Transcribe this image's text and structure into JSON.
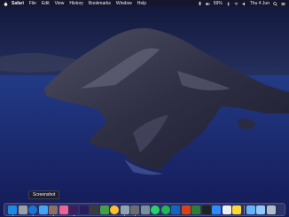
{
  "menubar": {
    "app_name": "Safari",
    "items": [
      "File",
      "Edit",
      "View",
      "History",
      "Bookmarks",
      "Window",
      "Help"
    ],
    "battery_percent": "59%",
    "clock": "Thu 4 Jun",
    "status_icons": [
      "dropbox-icon",
      "wifi-icon",
      "bluetooth-icon",
      "volume-icon",
      "spotlight-icon",
      "siri-icon",
      "menu-extra-icon"
    ]
  },
  "tooltip": {
    "label": "Screenshot"
  },
  "dock": {
    "apps": [
      {
        "name": "finder-icon",
        "color": "#1e88e5"
      },
      {
        "name": "launchpad-icon",
        "color": "#9aa0a6"
      },
      {
        "name": "safari-icon",
        "color": "#1976d2"
      },
      {
        "name": "mail-icon",
        "color": "#42a5f5"
      },
      {
        "name": "contacts-icon",
        "color": "#8d6e63"
      },
      {
        "name": "photos-icon",
        "color": "#f06292"
      },
      {
        "name": "premiere-icon",
        "color": "#3f1d5c"
      },
      {
        "name": "after-effects-icon",
        "color": "#2a1b5e"
      },
      {
        "name": "quicktime-icon",
        "color": "#3a3a3a"
      },
      {
        "name": "facetime-icon",
        "color": "#43a047"
      },
      {
        "name": "chrome-icon",
        "color": "#fbc02d"
      },
      {
        "name": "preview-icon",
        "color": "#90a4ae"
      },
      {
        "name": "screenshot-icon",
        "color": "#6d6d6d"
      },
      {
        "name": "system-preferences-icon",
        "color": "#78909c"
      },
      {
        "name": "whatsapp-icon",
        "color": "#25d366"
      },
      {
        "name": "spotify-icon",
        "color": "#1db954"
      },
      {
        "name": "word-icon",
        "color": "#1565c0"
      },
      {
        "name": "powerpoint-icon",
        "color": "#d84315"
      },
      {
        "name": "excel-icon",
        "color": "#2e7d32"
      },
      {
        "name": "terminal-icon",
        "color": "#212121"
      },
      {
        "name": "zoom-icon",
        "color": "#2d8cff"
      },
      {
        "name": "calendar-icon",
        "color": "#eceff1"
      },
      {
        "name": "notes-icon",
        "color": "#fdd835"
      }
    ],
    "right_items": [
      {
        "name": "downloads-folder-icon",
        "color": "#64b5f6"
      },
      {
        "name": "documents-folder-icon",
        "color": "#90caf9"
      },
      {
        "name": "trash-icon",
        "color": "#b0bec5"
      }
    ]
  }
}
